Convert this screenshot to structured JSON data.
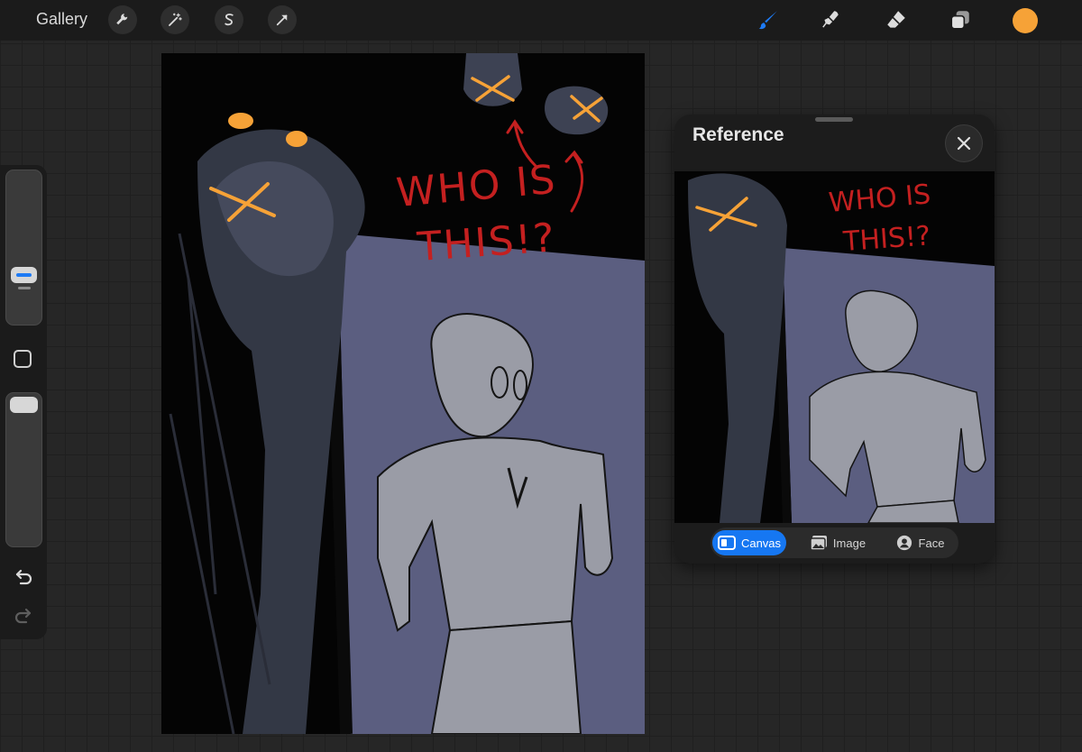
{
  "toolbar": {
    "gallery_label": "Gallery",
    "left_tools": [
      "wrench-icon",
      "magic-wand-icon",
      "selection-icon",
      "transform-arrow-icon"
    ],
    "right_tools": [
      "brush-icon",
      "smudge-icon",
      "eraser-icon",
      "layers-icon"
    ],
    "active_tool": "brush-icon",
    "accent_color": "#1e7bf5",
    "current_color": "#f6a237"
  },
  "sidebar": {
    "brush_size_level": 0.38,
    "brush_opacity_level": 1.0
  },
  "canvas": {
    "annotation_text_line1": "WHO IS",
    "annotation_text_line2": "THIS!?",
    "background_color": "#5b5e80",
    "ink_color": "#c42020",
    "highlight_color": "#f6a237"
  },
  "reference": {
    "title": "Reference",
    "tabs": [
      {
        "label": "Canvas",
        "active": true
      },
      {
        "label": "Image",
        "active": false
      },
      {
        "label": "Face",
        "active": false
      }
    ]
  }
}
